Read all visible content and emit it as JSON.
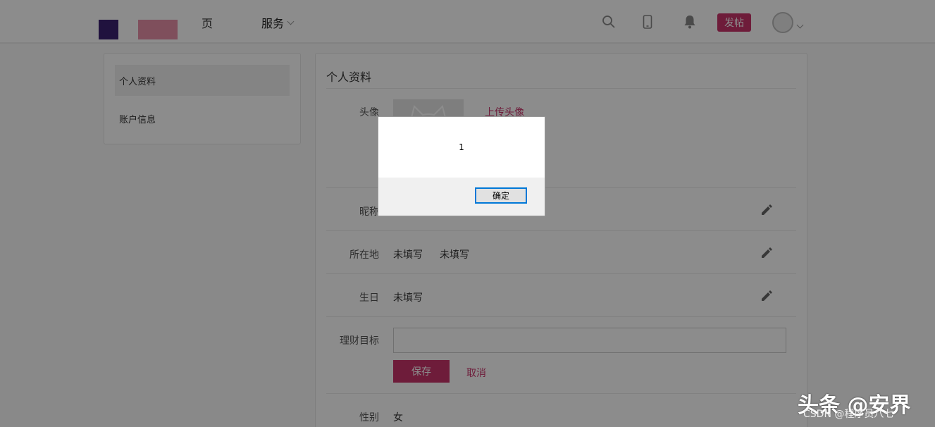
{
  "colors": {
    "brand_pink": "#c8336a",
    "brand_purple": "#3b2171",
    "logo_pink": "#e890a8"
  },
  "header": {
    "nav_home": "页",
    "nav_service": "服务",
    "post_button": "发帖"
  },
  "sidebar": {
    "items": [
      {
        "label": "个人资料",
        "active": true
      },
      {
        "label": "账户信息",
        "active": false
      }
    ]
  },
  "profile": {
    "title": "个人资料",
    "avatar_label": "头像",
    "upload_link": "上传头像",
    "nickname_label": "昵称",
    "location_label": "所在地",
    "location_province": "未填写",
    "location_city": "未填写",
    "birthday_label": "生日",
    "birthday_value": "未填写",
    "goal_label": "理财目标",
    "goal_value": "",
    "save_button": "保存",
    "cancel_link": "取消",
    "gender_label": "性别",
    "gender_value": "女"
  },
  "dialog": {
    "message": "1",
    "ok_button": "确定"
  },
  "watermark": {
    "main": "头条 @安界",
    "sub": "CSDN @程序员八七"
  }
}
